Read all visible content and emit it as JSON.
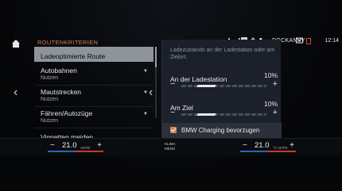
{
  "status_bar": {
    "user": "ROCKANBY",
    "time": "12:14",
    "mic_badge": "↑",
    "icons": [
      "media-icon",
      "phone-signal-icon",
      "bluetooth-icon",
      "mic-badge-icon",
      "battery-icon"
    ]
  },
  "left_panel": {
    "section_title": "ROUTENKRITERIEN",
    "items": [
      {
        "label": "Ladeoptimierte Route",
        "sub": ""
      },
      {
        "label": "Autobahnen",
        "sub": "Nutzen"
      },
      {
        "label": "Mautstrecken",
        "sub": "Nutzen"
      },
      {
        "label": "Fähren/Autozüge",
        "sub": "Nutzen"
      },
      {
        "label": "Vignetten meiden",
        "sub": ""
      }
    ]
  },
  "right_panel": {
    "info_text": "Ladezustands an der Ladestation oder am Zielort.",
    "charging_station": {
      "label": "An der Ladestation",
      "value": "10%",
      "level": 0.1
    },
    "destination": {
      "label": "Am Ziel",
      "value": "10%",
      "level": 0.1
    },
    "checkbox": {
      "label": "BMW Charging bevorzugen",
      "checked": true
    }
  },
  "climate": {
    "left": {
      "temp": "21.0",
      "unit": "AUTO",
      "minus": "−",
      "plus": "+"
    },
    "right": {
      "temp": "21.0",
      "unit": "°C AUTO",
      "minus": "−",
      "plus": "+"
    },
    "menu_line1": "KLIMA",
    "menu_line2": "MENÜ"
  },
  "colors": {
    "accent": "#c9875a",
    "selected_bg": "#8e949c",
    "panel_bg": "#1d222c",
    "cold": "#2f63b8",
    "warm": "#c8362e"
  }
}
